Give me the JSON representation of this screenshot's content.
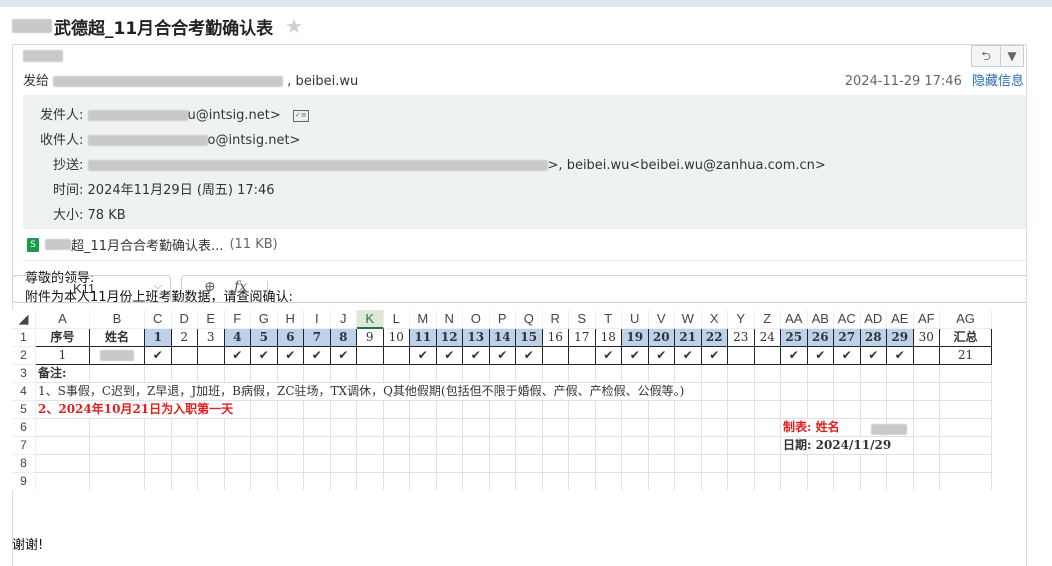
{
  "subject": "武德超_11月合合考勤确认表",
  "sender_name": "武德超",
  "to_prefix": "发给",
  "to_last": ", beibei.wu",
  "date": "2024-11-29 17:46",
  "hide_details": "隐藏信息",
  "meta": {
    "from_label": "发件人:",
    "from_value": "u@intsig.net>",
    "to_label": "收件人:",
    "to_value": "o@intsig.net>",
    "cc_label": "抄送:",
    "cc_tail": ">,  beibei.wu<beibei.wu@zanhua.com.cn>",
    "time_label": "时间:",
    "time_value": "2024年11月29日 (周五) 17:46",
    "size_label": "大小:",
    "size_value": "78 KB"
  },
  "attachment": {
    "name": "超_11月合合考勤确认表...",
    "size": "(11 KB)"
  },
  "greeting": [
    "尊敬的领导:",
    "附件为本人11月份上班考勤数据，请查阅确认:"
  ],
  "sheet": {
    "name_box": "K11",
    "columns": [
      "A",
      "B",
      "C",
      "D",
      "E",
      "F",
      "G",
      "H",
      "I",
      "J",
      "K",
      "L",
      "M",
      "N",
      "O",
      "P",
      "Q",
      "R",
      "S",
      "T",
      "U",
      "V",
      "W",
      "X",
      "Y",
      "Z",
      "AA",
      "AB",
      "AC",
      "AD",
      "AE",
      "AF",
      "AG"
    ],
    "row_numbers": [
      "1",
      "2",
      "3",
      "4",
      "5",
      "6",
      "7",
      "8",
      "9"
    ],
    "header_row": {
      "no": "序号",
      "name": "姓名",
      "days": [
        "1",
        "2",
        "3",
        "4",
        "5",
        "6",
        "7",
        "8",
        "9",
        "10",
        "11",
        "12",
        "13",
        "14",
        "15",
        "16",
        "17",
        "18",
        "19",
        "20",
        "21",
        "22",
        "23",
        "24",
        "25",
        "26",
        "27",
        "28",
        "29",
        "30"
      ],
      "total": "汇总"
    },
    "data_row": {
      "no": "1",
      "marks": [
        "✔",
        "",
        "",
        "✔",
        "✔",
        "✔",
        "✔",
        "✔",
        "",
        "",
        "✔",
        "✔",
        "✔",
        "✔",
        "✔",
        "",
        "",
        "✔",
        "✔",
        "✔",
        "✔",
        "✔",
        "",
        "",
        "✔",
        "✔",
        "✔",
        "✔",
        "✔",
        ""
      ],
      "total": "21"
    },
    "note_title": "备注:",
    "note_1": "1、S事假，C迟到，Z早退，J加班，B病假，ZC驻场，TX调休，Q其他假期(包括但不限于婚假、产假、产检假、公假等。)",
    "note_2": "2、2024年10月21日为入职第一天",
    "maker": "制表: 姓名",
    "sheet_date": "日期:  2024/11/29"
  },
  "thanks": "谢谢!",
  "colors": {
    "accent": "#2a6bb4",
    "highlight": "#bdd1ea",
    "red": "#e02020",
    "selected": "#217346"
  }
}
